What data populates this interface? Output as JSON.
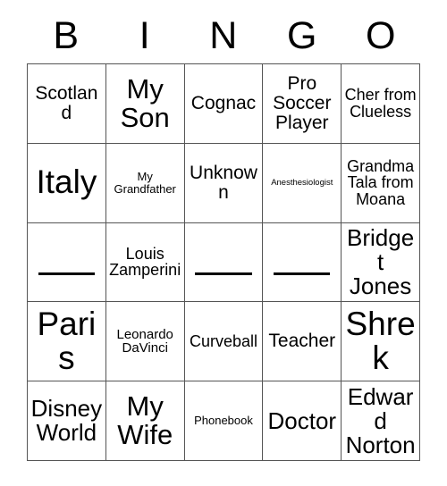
{
  "card": {
    "header_letters": [
      "B",
      "I",
      "N",
      "G",
      "O"
    ],
    "colors": {
      "grid_line": "#555555",
      "text": "#000000",
      "background": "#ffffff"
    },
    "rows": [
      [
        {
          "text": "Scotland",
          "size": "md",
          "blank": false
        },
        {
          "text": "My Son",
          "size": "xl",
          "blank": false
        },
        {
          "text": "Cognac",
          "size": "md",
          "blank": false
        },
        {
          "text": "Pro Soccer Player",
          "size": "md",
          "blank": false
        },
        {
          "text": "Cher from Clueless",
          "size": "sm",
          "blank": false
        }
      ],
      [
        {
          "text": "Italy",
          "size": "xxl",
          "blank": false
        },
        {
          "text": "My Grandfather",
          "size": "xxs",
          "blank": false
        },
        {
          "text": "Unknown",
          "size": "md",
          "blank": false
        },
        {
          "text": "Anesthesiologist",
          "size": "tiny",
          "blank": false
        },
        {
          "text": "Grandma Tala from Moana",
          "size": "sm",
          "blank": false
        }
      ],
      [
        {
          "text": "________",
          "size": "md",
          "blank": true
        },
        {
          "text": "Louis Zamperini",
          "size": "sm",
          "blank": false
        },
        {
          "text": "________",
          "size": "md",
          "blank": true
        },
        {
          "text": "________",
          "size": "md",
          "blank": true
        },
        {
          "text": "Bridget Jones",
          "size": "lg",
          "blank": false
        }
      ],
      [
        {
          "text": "Paris",
          "size": "xxl",
          "blank": false
        },
        {
          "text": "Leonardo DaVinci",
          "size": "xs",
          "blank": false
        },
        {
          "text": "Curveball",
          "size": "sm",
          "blank": false
        },
        {
          "text": "Teacher",
          "size": "md",
          "blank": false
        },
        {
          "text": "Shrek",
          "size": "xxl",
          "blank": false
        }
      ],
      [
        {
          "text": "Disney World",
          "size": "lg",
          "blank": false
        },
        {
          "text": "My Wife",
          "size": "xl",
          "blank": false
        },
        {
          "text": "Phonebook",
          "size": "xxs",
          "blank": false
        },
        {
          "text": "Doctor",
          "size": "lg",
          "blank": false
        },
        {
          "text": "Edward Norton",
          "size": "lg",
          "blank": false
        }
      ]
    ]
  }
}
